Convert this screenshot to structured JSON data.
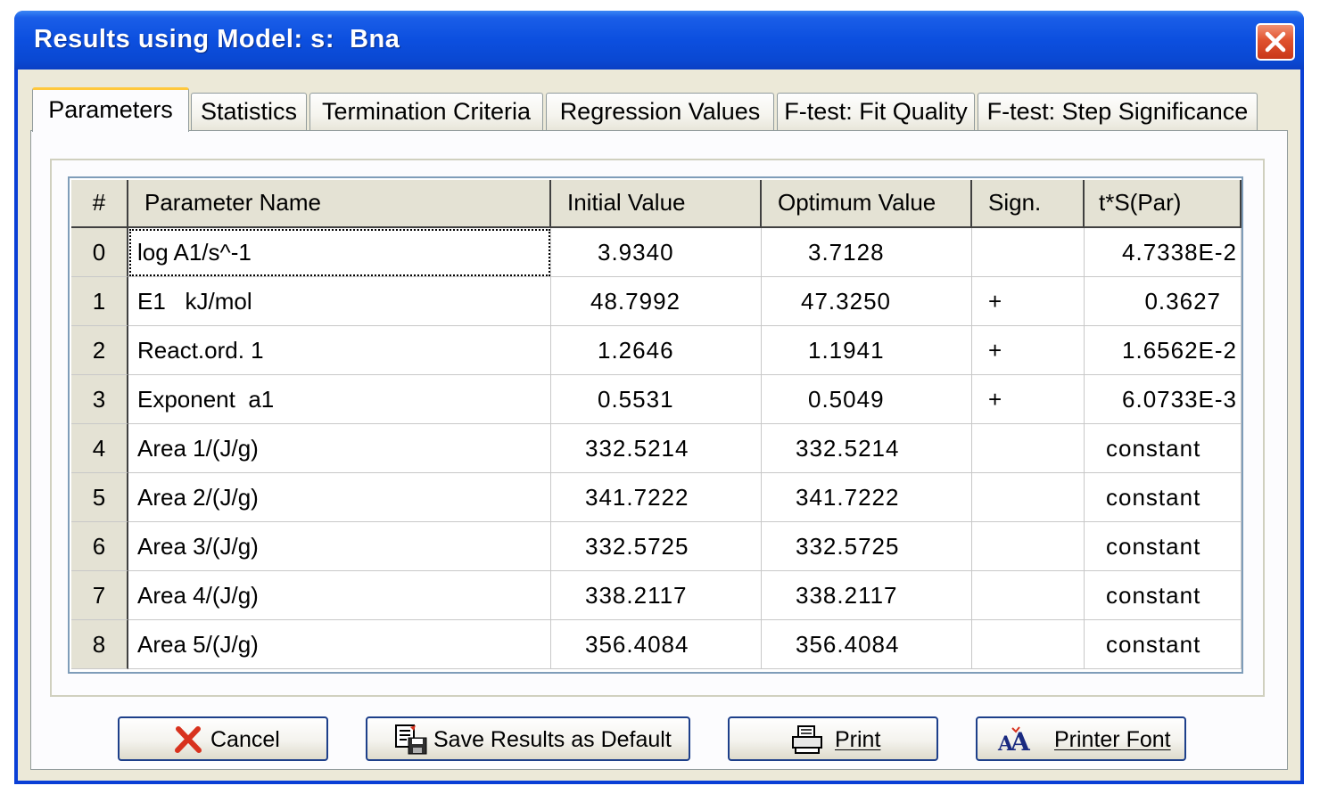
{
  "window": {
    "title": "Results using Model: s:  Bna",
    "close_icon": "close-x-icon"
  },
  "tabs": [
    {
      "label": "Parameters",
      "active": true
    },
    {
      "label": "Statistics",
      "active": false
    },
    {
      "label": "Termination Criteria",
      "active": false
    },
    {
      "label": "Regression Values",
      "active": false
    },
    {
      "label": "F-test: Fit Quality",
      "active": false
    },
    {
      "label": "F-test: Step Significance",
      "active": false
    }
  ],
  "table": {
    "columns": [
      "#",
      "Parameter Name",
      "Initial Value",
      "Optimum Value",
      "Sign.",
      "t*S(Par)"
    ],
    "rows": [
      {
        "index": "0",
        "name": "log A1/s^-1",
        "initial": "3.9340",
        "optimum": "3.7128",
        "sign": "",
        "tsp": "4.7338E-2"
      },
      {
        "index": "1",
        "name": "E1   kJ/mol",
        "initial": "48.7992",
        "optimum": "47.3250",
        "sign": "+",
        "tsp": "0.3627"
      },
      {
        "index": "2",
        "name": "React.ord. 1",
        "initial": "1.2646",
        "optimum": "1.1941",
        "sign": "+",
        "tsp": "1.6562E-2"
      },
      {
        "index": "3",
        "name": "Exponent  a1",
        "initial": "0.5531",
        "optimum": "0.5049",
        "sign": "+",
        "tsp": "6.0733E-3"
      },
      {
        "index": "4",
        "name": "Area 1/(J/g)",
        "initial": "332.5214",
        "optimum": "332.5214",
        "sign": "",
        "tsp": "constant"
      },
      {
        "index": "5",
        "name": "Area 2/(J/g)",
        "initial": "341.7222",
        "optimum": "341.7222",
        "sign": "",
        "tsp": "constant"
      },
      {
        "index": "6",
        "name": "Area 3/(J/g)",
        "initial": "332.5725",
        "optimum": "332.5725",
        "sign": "",
        "tsp": "constant"
      },
      {
        "index": "7",
        "name": "Area 4/(J/g)",
        "initial": "338.2117",
        "optimum": "338.2117",
        "sign": "",
        "tsp": "constant"
      },
      {
        "index": "8",
        "name": "Area 5/(J/g)",
        "initial": "356.4084",
        "optimum": "356.4084",
        "sign": "",
        "tsp": "constant"
      }
    ]
  },
  "buttons": {
    "cancel": {
      "label": "Cancel",
      "icon": "red-x-icon"
    },
    "save_default": {
      "label": "Save Results as Default",
      "icon": "save-document-icon"
    },
    "print": {
      "label": "Print",
      "icon": "printer-icon"
    },
    "printer_font": {
      "label": "Printer Font",
      "icon": "font-aa-icon"
    }
  },
  "colors": {
    "titlebar": "#0c4fdf",
    "dialog_bg": "#ece9d8",
    "active_tab_accent": "#ffc83c",
    "grid_border": "#7f9db9",
    "header_bg": "#e4e2d4",
    "cancel_icon": "#d8321e"
  }
}
